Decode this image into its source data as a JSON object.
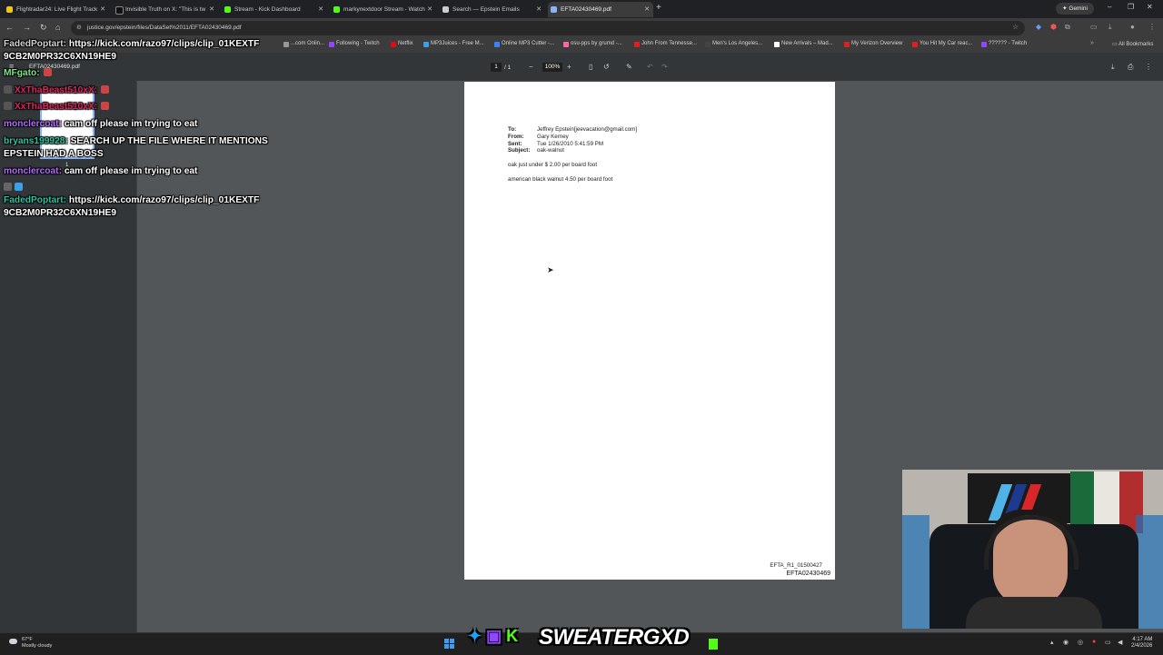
{
  "tabs": [
    {
      "label": "Flightradar24: Live Flight Track",
      "color": "#f5c518"
    },
    {
      "label": "Invisible Truth on X: \"This is tw",
      "color": "#111111"
    },
    {
      "label": "Stream - Kick Dashboard",
      "color": "#53fc18"
    },
    {
      "label": "markynextdoor Stream - Watch",
      "color": "#53fc18"
    },
    {
      "label": "Search — Epstein Emails",
      "color": "#cccccc"
    },
    {
      "label": "EFTA02430469.pdf",
      "color": "#8ab4f8"
    }
  ],
  "gemini_label": "Gemini",
  "address": "justice.gov/epstein/files/DataSet%2011/EFTA02430469.pdf",
  "bookmarks": [
    "...com Onlin...",
    "Following - Twitch",
    "Netflix",
    "MP3Juices - Free M...",
    "Online MP3 Cutter -...",
    "osu-pps by grumd -...",
    "John From Tennesse...",
    "Men's Los Angeles...",
    "New Arrivals – Mad...",
    "My Verizon Overview",
    "You Hit My Car reac...",
    "?????? - Twitch"
  ],
  "all_bookmarks": "All Bookmarks",
  "pdf": {
    "title": "EFTA02430469.pdf",
    "page_current": "1",
    "page_sep": "/  1",
    "zoom": "100%",
    "thumb_number": "1",
    "header": {
      "to_label": "To:",
      "to_value": "Jeffrey Epstein[jeevacation@gmail.com]",
      "from_label": "From:",
      "from_value": "Gary Kerney",
      "sent_label": "Sent:",
      "sent_value": "Tue 1/26/2010 5:41:59 PM",
      "subject_label": "Subject:",
      "subject_value": "oak-walnut"
    },
    "body": [
      "oak just under $ 2.00 per board foot",
      "american black walnut  4.50 per board foot"
    ],
    "footer_ref": "EFTA_R1_01500427",
    "footer_id": "EFTA02430469"
  },
  "chat": [
    {
      "user": "FadedPoptart:",
      "text": " https://kick.com/razo97/clips/clip_01KEXTF\n9CB2M0PR32C6XN19HE9",
      "color": "#d0d0d0"
    },
    {
      "user": "MFgato:",
      "text": "",
      "color": "#7ee787"
    },
    {
      "user": "XxThaBeast510xX:",
      "text": "",
      "color": "#e0245e"
    },
    {
      "user": "XxThaBeast510xX:",
      "text": "",
      "color": "#e0245e"
    },
    {
      "user": "monclercoat:",
      "text": " cam off please im trying to eat",
      "color": "#b36bff"
    },
    {
      "user": "bryans199928:",
      "text": " SEARCH UP THE FILE WHERE IT MENTIONS\nEPSTEIN HAD A BOSS",
      "color": "#2ec4a0"
    },
    {
      "user": "monclercoat:",
      "text": " cam off please im trying to eat",
      "color": "#b36bff"
    },
    {
      "user": "FadedPoptart:",
      "text": " https://kick.com/razo97/clips/clip_01KEXTF\n9CB2M0PR32C6XN19HE9",
      "color": "#2ec4a0"
    }
  ],
  "overlay_name": "SWEATERGXD",
  "weather": {
    "temp": "67°F",
    "desc": "Mostly cloudy"
  },
  "clock": {
    "time": "4:17 AM",
    "date": "2/4/2026"
  }
}
